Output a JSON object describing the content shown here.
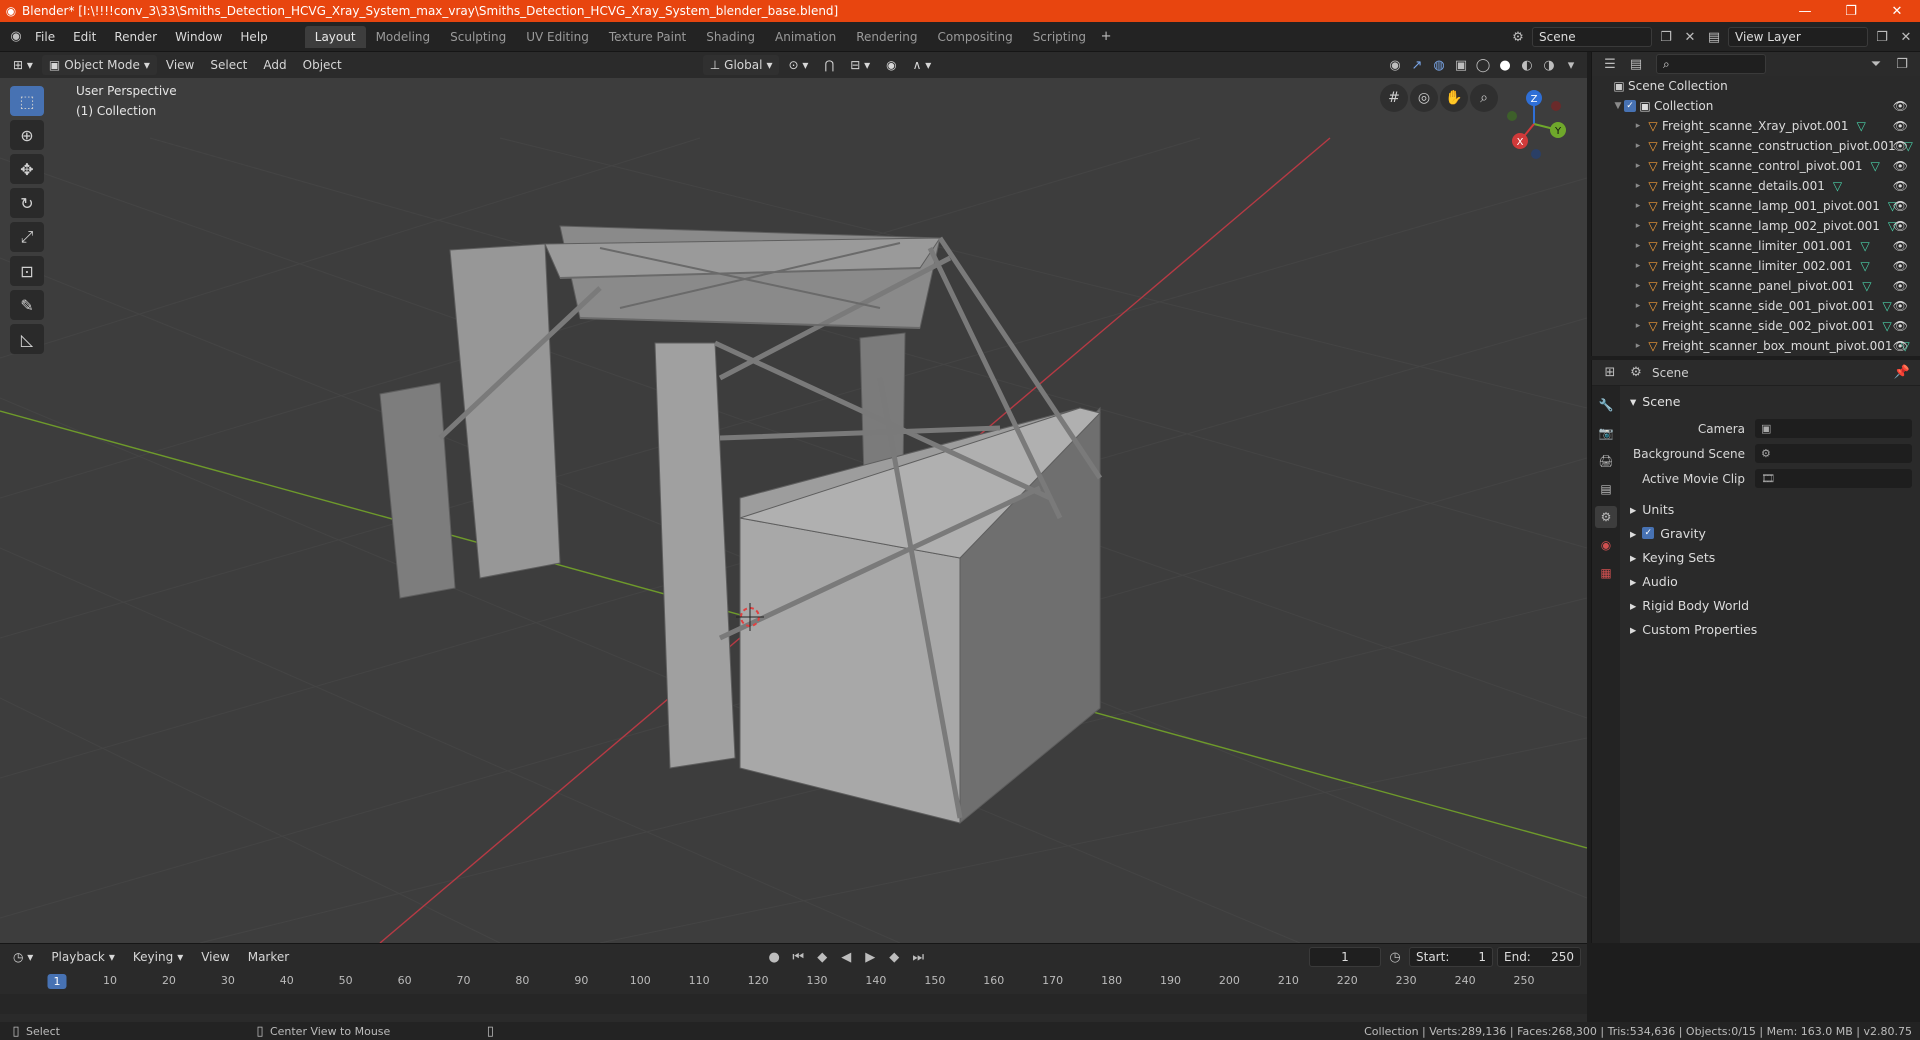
{
  "title_bar": {
    "title": "Blender* [I:\\!!!!conv_3\\33\\Smiths_Detection_HCVG_Xray_System_max_vray\\Smiths_Detection_HCVG_Xray_System_blender_base.blend]"
  },
  "menu": [
    "File",
    "Edit",
    "Render",
    "Window",
    "Help"
  ],
  "workspaces": [
    "Layout",
    "Modeling",
    "Sculpting",
    "UV Editing",
    "Texture Paint",
    "Shading",
    "Animation",
    "Rendering",
    "Compositing",
    "Scripting"
  ],
  "active_workspace": "Layout",
  "scene_field": "Scene",
  "view_layer_field": "View Layer",
  "viewport_header": {
    "mode": "Object Mode",
    "view": "View",
    "select": "Select",
    "add": "Add",
    "object": "Object",
    "transform": "Global"
  },
  "viewport": {
    "perspective": "User Perspective",
    "collection": "(1) Collection",
    "axis_x": "X",
    "axis_y": "Y",
    "axis_z": "Z"
  },
  "outliner": {
    "root": "Scene Collection",
    "collection": "Collection",
    "items": [
      "Freight_scanne_Xray_pivot.001",
      "Freight_scanne_construction_pivot.001",
      "Freight_scanne_control_pivot.001",
      "Freight_scanne_details.001",
      "Freight_scanne_lamp_001_pivot.001",
      "Freight_scanne_lamp_002_pivot.001",
      "Freight_scanne_limiter_001.001",
      "Freight_scanne_limiter_002.001",
      "Freight_scanne_panel_pivot.001",
      "Freight_scanne_side_001_pivot.001",
      "Freight_scanne_side_002_pivot.001",
      "Freight_scanner_box_mount_pivot.001"
    ]
  },
  "properties": {
    "header": "Scene",
    "panel": "Scene",
    "camera_label": "Camera",
    "bg_scene_label": "Background Scene",
    "movie_clip_label": "Active Movie Clip",
    "subpanels": [
      "Units",
      "Gravity",
      "Keying Sets",
      "Audio",
      "Rigid Body World",
      "Custom Properties"
    ]
  },
  "timeline": {
    "playback": "Playback",
    "keying": "Keying",
    "view": "View",
    "marker": "Marker",
    "current_frame": "1",
    "start_label": "Start:",
    "start": "1",
    "end_label": "End:",
    "end": "250",
    "ticks": [
      "1",
      "10",
      "20",
      "30",
      "40",
      "50",
      "60",
      "70",
      "80",
      "90",
      "100",
      "110",
      "120",
      "130",
      "140",
      "150",
      "160",
      "170",
      "180",
      "190",
      "200",
      "210",
      "220",
      "230",
      "240",
      "250"
    ]
  },
  "status": {
    "left": "Select",
    "mid": "Center View to Mouse",
    "right": "Collection | Verts:289,136 | Faces:268,300 | Tris:534,636 | Objects:0/15 | Mem: 163.0 MB | v2.80.75"
  }
}
